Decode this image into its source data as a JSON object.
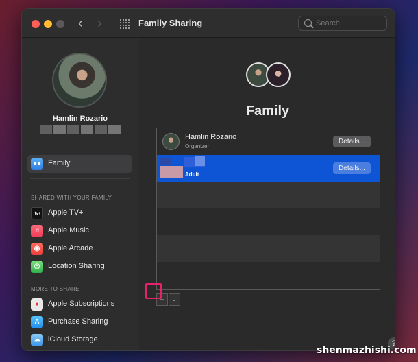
{
  "window": {
    "title": "Family Sharing"
  },
  "search": {
    "placeholder": "Search"
  },
  "profile": {
    "name": "Hamlin Rozario"
  },
  "sidebar": {
    "selected": {
      "label": "Family",
      "icon": "family-icon"
    },
    "section1": "SHARED WITH YOUR FAMILY",
    "shared_items": [
      {
        "label": "Apple TV+",
        "icon": "apple-tv-icon"
      },
      {
        "label": "Apple Music",
        "icon": "music-note-icon"
      },
      {
        "label": "Apple Arcade",
        "icon": "arcade-joystick-icon"
      },
      {
        "label": "Location Sharing",
        "icon": "location-icon"
      }
    ],
    "section2": "MORE TO SHARE",
    "more_items": [
      {
        "label": "Apple Subscriptions",
        "icon": "subscriptions-icon"
      },
      {
        "label": "Purchase Sharing",
        "icon": "app-store-icon"
      },
      {
        "label": "iCloud Storage",
        "icon": "icloud-icon"
      }
    ]
  },
  "main": {
    "title": "Family",
    "members": [
      {
        "name": "Hamlin Rozario",
        "role": "Organizer",
        "button": "Details..."
      },
      {
        "name": "",
        "role": "Adult",
        "button": "Details..."
      }
    ],
    "add_label": "+",
    "remove_label": "-",
    "help_label": "?"
  },
  "watermark": "shenmazhishi.com",
  "colors": {
    "accent": "#0d55d4",
    "highlight": "#e8226a"
  }
}
